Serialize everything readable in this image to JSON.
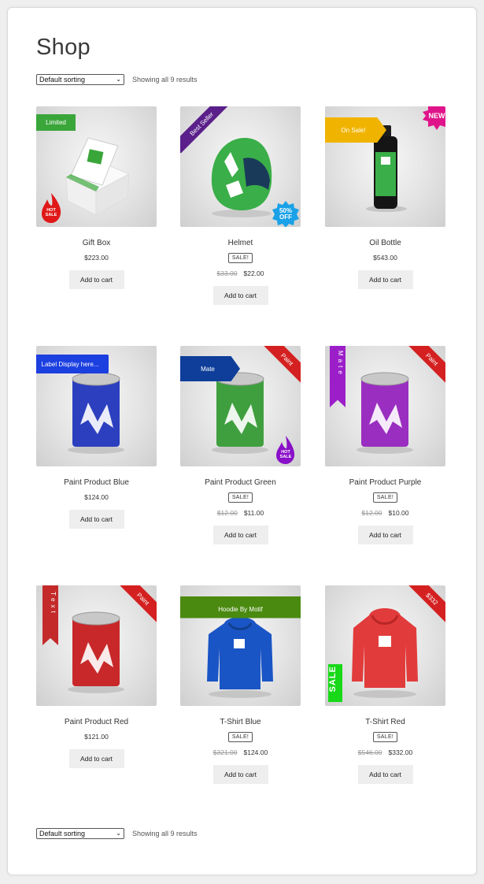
{
  "page": {
    "title": "Shop"
  },
  "toolbar": {
    "sort": "Default sorting",
    "count": "Showing all 9 results"
  },
  "products": [
    {
      "name": "Gift Box",
      "price": "$223.00",
      "cart": "Add to cart",
      "badges": [
        "Limited",
        "HOT SALE"
      ]
    },
    {
      "name": "Helmet",
      "sale": "SALE!",
      "old_price": "$33.00",
      "price": "$22.00",
      "cart": "Add to cart",
      "badges": [
        "Best Seller",
        "50% OFF"
      ]
    },
    {
      "name": "Oil Bottle",
      "price": "$543.00",
      "cart": "Add to cart",
      "badges": [
        "On Sale!",
        "NEW"
      ]
    },
    {
      "name": "Paint Product Blue",
      "price": "$124.00",
      "cart": "Add to cart",
      "badges": [
        "Label Display here..."
      ]
    },
    {
      "name": "Paint Product Green",
      "sale": "SALE!",
      "old_price": "$12.00",
      "price": "$11.00",
      "cart": "Add to cart",
      "badges": [
        "Mate",
        "Paint",
        "HOT SALE"
      ]
    },
    {
      "name": "Paint Product Purple",
      "sale": "SALE!",
      "old_price": "$12.00",
      "price": "$10.00",
      "cart": "Add to cart",
      "badges": [
        "Mate",
        "Paint"
      ]
    },
    {
      "name": "Paint Product Red",
      "price": "$121.00",
      "cart": "Add to cart",
      "badges": [
        "Text",
        "Paint"
      ]
    },
    {
      "name": "T-Shirt Blue",
      "sale": "SALE!",
      "old_price": "$321.00",
      "price": "$124.00",
      "cart": "Add to cart",
      "badges": [
        "Hoodie By Motif"
      ]
    },
    {
      "name": "T-Shirt Red",
      "sale": "SALE!",
      "old_price": "$546.00",
      "price": "$332.00",
      "cart": "Add to cart",
      "badges": [
        "$332",
        "SALE"
      ]
    }
  ],
  "colors": {
    "green": "#3aa63a",
    "purple": "#5a1f8a",
    "blue_burst": "#1aa1e8",
    "orange": "#f0b400",
    "pink": "#e0148a",
    "blue": "#1c3fe0",
    "navy": "#0e3e9a",
    "red": "#d42020",
    "violet": "#9b1ec9",
    "hoodie_green": "#4a8a10",
    "lime": "#18d818"
  }
}
